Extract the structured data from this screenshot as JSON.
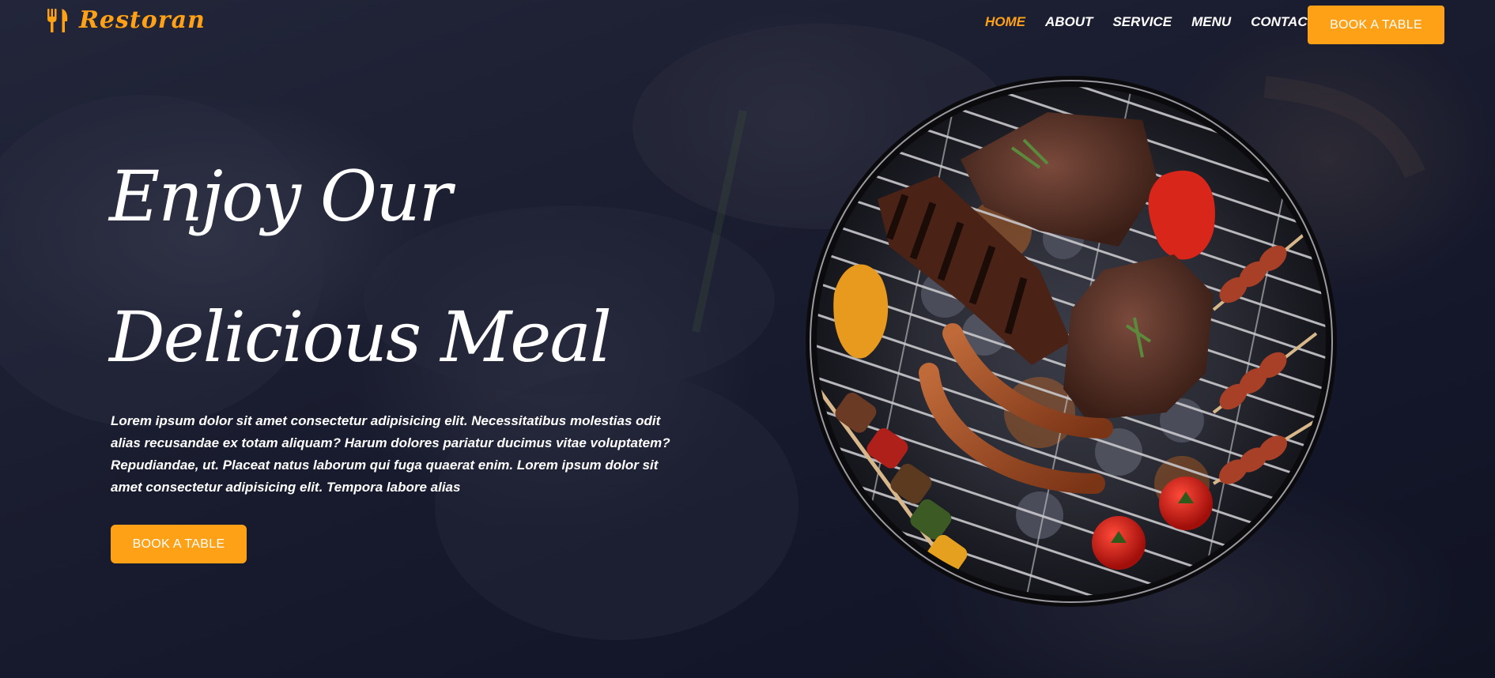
{
  "brand": {
    "name": "Restoran",
    "icon": "utensils-icon",
    "color": "#fea116"
  },
  "nav": {
    "items": [
      {
        "label": "HOME",
        "active": true
      },
      {
        "label": "ABOUT",
        "active": false
      },
      {
        "label": "SERVICE",
        "active": false
      },
      {
        "label": "MENU",
        "active": false
      },
      {
        "label": "CONTACT",
        "active": false
      }
    ],
    "cta_label": "BOOK A TABLE"
  },
  "hero": {
    "title_line1": "Enjoy Our",
    "title_line2": "Delicious Meal",
    "text": "Lorem ipsum dolor sit amet consectetur adipisicing elit. Necessitatibus molestias odit alias recusandae ex totam aliquam? Harum dolores pariatur ducimus vitae voluptatem? Repudiandae, ut. Placeat natus laborum qui fuga quaerat enim. Lorem ipsum dolor sit amet consectetur adipisicing elit. Tempora labore alias",
    "cta_label": "BOOK A TABLE",
    "image": "bbq-grill-image"
  },
  "colors": {
    "accent": "#fea116",
    "background": "#1a1d2f",
    "text": "#ffffff"
  }
}
